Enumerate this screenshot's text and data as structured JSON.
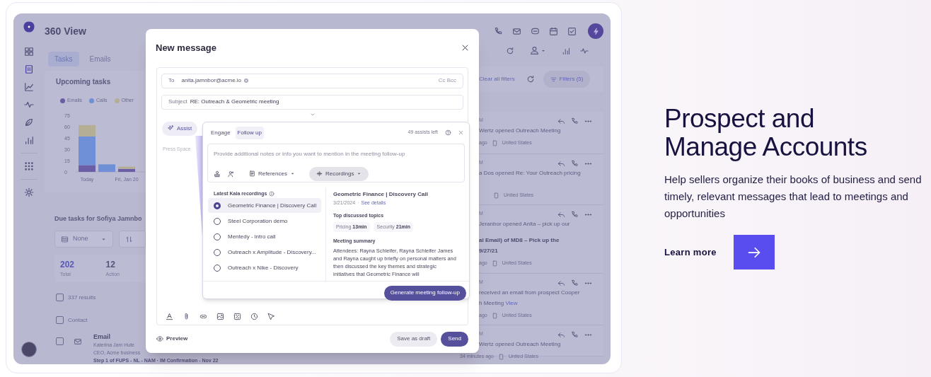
{
  "app": {
    "title": "360 View",
    "tabs": [
      {
        "label": "Tasks",
        "selected": true
      },
      {
        "label": "Emails",
        "selected": false
      }
    ],
    "upcoming": {
      "title": "Upcoming tasks",
      "chart_data": {
        "type": "bar",
        "stacked": true,
        "categories": [
          "Today",
          null,
          "Fri, Jan 20"
        ],
        "yticks": [
          0,
          15,
          30,
          45,
          60,
          75
        ],
        "ylim": [
          0,
          75
        ],
        "series": [
          {
            "name": "Emails",
            "color": "#6a5fa6",
            "values": [
              9,
              0,
              4
            ]
          },
          {
            "name": "Calls",
            "color": "#6f8fd6",
            "values": [
              38,
              10,
              0
            ]
          },
          {
            "name": "Other",
            "color": "#b3ae94",
            "values": [
              15,
              0,
              3
            ]
          }
        ]
      }
    },
    "due": {
      "title": "Due tasks for Sofiya Jamnbo",
      "filter": "None",
      "stats": [
        {
          "value": "202",
          "label": "Total",
          "selected": true
        },
        {
          "value": "12",
          "label": "Action",
          "selected": false
        }
      ],
      "results": {
        "label": "337 results",
        "checked": false
      },
      "column": {
        "label": "Contact",
        "checked": false
      },
      "row": {
        "checked": false,
        "type": "Email",
        "name": "Katerina Jam Hute",
        "title": "CEO, Acme business",
        "step": "Step 1 of FUPS - NL - NAM · IM Confirmation - Nov 22"
      }
    },
    "filters": {
      "clear": "Clear all filters",
      "button": "Filters (5)"
    },
    "activity": [
      {
        "time": "M",
        "lines": [
          {
            "text": "Wertz opened Outreach Meeting",
            "bold": false
          }
        ],
        "ago": "ago",
        "location": "United States"
      },
      {
        "time": "M",
        "lines": [
          {
            "text": "a Dos opened Re: Your Outreach pricing",
            "bold": false
          }
        ],
        "location": "United States"
      },
      {
        "time": "M",
        "lines": [
          {
            "text": "Jeranbor opened Anita – pick up our",
            "bold": false
          },
          {
            "text": "al Email) of MD8 – Pick up the",
            "bold": true
          },
          {
            "text": "9/27/21",
            "bold": true
          }
        ],
        "ago": "ago",
        "location": "United States"
      },
      {
        "time": "M",
        "lines": [
          {
            "text": "received an email from prospect Cooper",
            "bold": false
          },
          {
            "text": "h Meeting",
            "bold": false,
            "link": "View"
          }
        ],
        "ago": "ago",
        "location": "United States"
      },
      {
        "time": "M",
        "lines": [
          {
            "text": "Wertz opened Outreach Meeting",
            "bold": false
          }
        ],
        "ago": "34 minutes ago",
        "location": "United States"
      }
    ]
  },
  "modal": {
    "title": "New message",
    "to": {
      "label": "To",
      "recipient": "anita.jamnbor@acme.io",
      "cc": "Cc Bcc"
    },
    "subject": {
      "label": "Subject",
      "value": "RE: Outreach & Geometric meeting"
    },
    "assist": "Assist",
    "editor_placeholder": "Press Space",
    "panel": {
      "tabs": [
        {
          "label": "Engage",
          "selected": false
        },
        {
          "label": "Follow up",
          "selected": true
        }
      ],
      "assists_left": "49 assists left",
      "notes_placeholder": "Provide additional notes or info you want to mention in the meeting follow-up",
      "sources": [
        {
          "label": "References",
          "selected": false
        },
        {
          "label": "Recordings",
          "selected": true
        }
      ],
      "recordings_title": "Latest Kaia recordings",
      "recordings": [
        {
          "label": "Geometric Finance | Discovery Call",
          "selected": true
        },
        {
          "label": "Steel Corporation demo",
          "selected": false
        },
        {
          "label": "Mentedy - intro call",
          "selected": false
        },
        {
          "label": "Outreach x Amplitude - Discovery...",
          "selected": false
        },
        {
          "label": "Outreach x Nike - Discovery",
          "selected": false
        }
      ],
      "detail": {
        "title": "Geometric Finance | Discovery Call",
        "date": "3/21/2024",
        "separator": "·",
        "link": "See details",
        "topics_title": "Top discussed topics",
        "topics": [
          {
            "name": "Pricing",
            "duration": "13min"
          },
          {
            "name": "Security",
            "duration": "21min"
          }
        ],
        "summary_title": "Meeting summary",
        "summary": "Attendees: Rayna Schleifer, Rayna Schleifer James and Rayna caught up briefly on personal matters and then discussed the key themes and strategic initiatives that Geometric Finance will"
      },
      "generate": "Generate meeting follow-up"
    },
    "preview": "Preview",
    "save": "Save as draft",
    "send": "Send"
  },
  "promo": {
    "title": "Prospect and Manage Accounts",
    "text": "Help sellers organize their books of business and send timely, relevant messages that lead to meetings and opportunities",
    "link": "Learn more"
  }
}
